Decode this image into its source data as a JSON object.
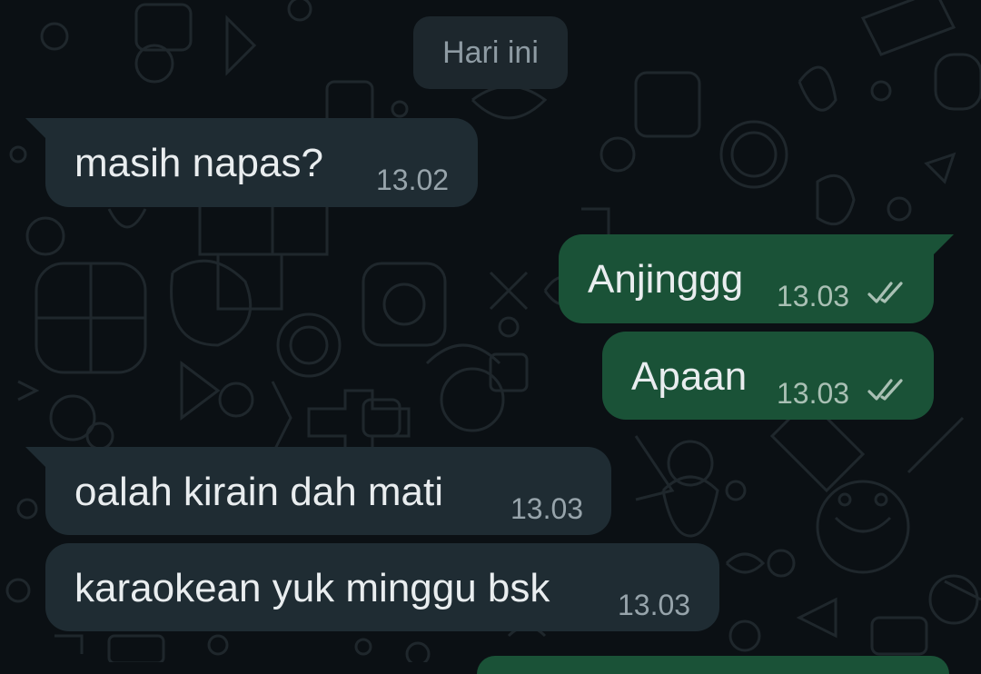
{
  "chat": {
    "date_divider": "Hari ini",
    "messages": [
      {
        "direction": "incoming",
        "text": "masih napas?",
        "time": "13.02"
      },
      {
        "direction": "outgoing",
        "text": "Anjinggg",
        "time": "13.03",
        "status_icon": "double-check-icon"
      },
      {
        "direction": "outgoing",
        "text": "Apaan",
        "time": "13.03",
        "status_icon": "double-check-icon"
      },
      {
        "direction": "incoming",
        "text": "oalah kirain dah mati",
        "time": "13.03"
      },
      {
        "direction": "incoming",
        "text": "karaokean yuk minggu bsk",
        "time": "13.03"
      }
    ]
  },
  "colors": {
    "background": "#0b1014",
    "incoming_bubble": "#1f2c33",
    "outgoing_bubble": "#1a5237",
    "date_chip": "#1d272d",
    "text": "#e9edef"
  }
}
